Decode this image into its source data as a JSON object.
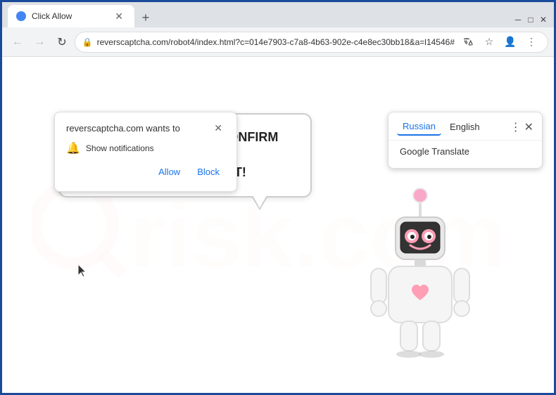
{
  "browser": {
    "tab_title": "Click Allow",
    "tab_favicon": "circle",
    "address": "reverscaptcha.com/robot4/index.html?c=014e7903-c7a8-4b63-902e-c4e8ec30bb18&a=l14546#",
    "new_tab_icon": "+",
    "back_icon": "←",
    "forward_icon": "→",
    "refresh_icon": "↻",
    "lock_icon": "🔒",
    "minimize_icon": "─",
    "maximize_icon": "□",
    "close_icon": "✕",
    "star_icon": "☆",
    "profile_icon": "👤",
    "more_icon": "⋮",
    "tab_close_icon": "✕"
  },
  "notification_popup": {
    "title": "reverscaptcha.com wants to",
    "permission_text": "Show notifications",
    "allow_label": "Allow",
    "block_label": "Block",
    "close_icon": "✕"
  },
  "translate_bar": {
    "tab_russian": "Russian",
    "tab_english": "English",
    "dots_icon": "⋮",
    "close_icon": "✕",
    "option_google_translate": "Google Translate"
  },
  "page": {
    "bubble_line1": "CLICK «ALLOW» TO CONFIRM THAT YOU",
    "bubble_line2": "ARE NOT A ROBOT!",
    "watermark": "risk.com"
  }
}
